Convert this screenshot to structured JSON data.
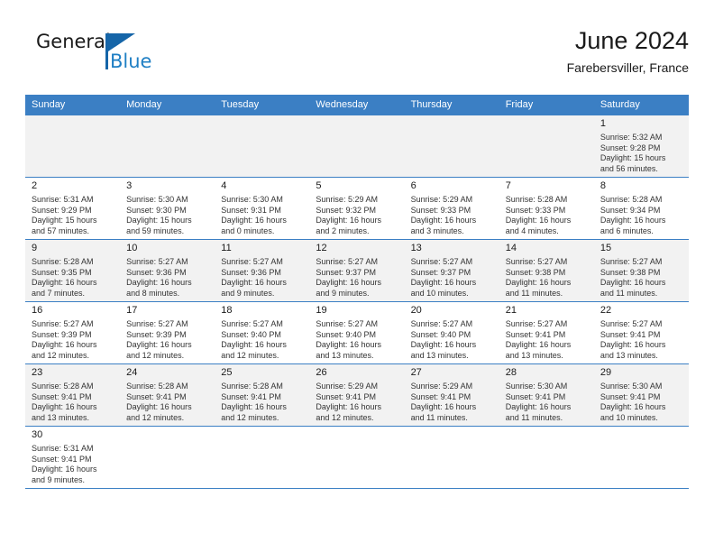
{
  "brand": {
    "name_part1": "General",
    "name_part2": "Blue",
    "logo_icon": "blue-flag-triangle",
    "accent_color": "#1f7fc4"
  },
  "header": {
    "title": "June 2024",
    "subtitle": "Farebersviller, France"
  },
  "theme": {
    "header_row_bg": "#3b7fc4",
    "cell_shade_bg": "#f2f2f2",
    "cell_plain_bg": "#ffffff",
    "border_color": "#3b7fc4"
  },
  "weekdays": [
    "Sunday",
    "Monday",
    "Tuesday",
    "Wednesday",
    "Thursday",
    "Friday",
    "Saturday"
  ],
  "labels": {
    "sunrise": "Sunrise:",
    "sunset": "Sunset:",
    "daylight": "Daylight:"
  },
  "weeks": [
    [
      {
        "day": "",
        "empty": true
      },
      {
        "day": "",
        "empty": true
      },
      {
        "day": "",
        "empty": true
      },
      {
        "day": "",
        "empty": true
      },
      {
        "day": "",
        "empty": true
      },
      {
        "day": "",
        "empty": true
      },
      {
        "day": "1",
        "sunrise": "Sunrise: 5:32 AM",
        "sunset": "Sunset: 9:28 PM",
        "daylight_line1": "Daylight: 15 hours",
        "daylight_line2": "and 56 minutes."
      }
    ],
    [
      {
        "day": "2",
        "sunrise": "Sunrise: 5:31 AM",
        "sunset": "Sunset: 9:29 PM",
        "daylight_line1": "Daylight: 15 hours",
        "daylight_line2": "and 57 minutes."
      },
      {
        "day": "3",
        "sunrise": "Sunrise: 5:30 AM",
        "sunset": "Sunset: 9:30 PM",
        "daylight_line1": "Daylight: 15 hours",
        "daylight_line2": "and 59 minutes."
      },
      {
        "day": "4",
        "sunrise": "Sunrise: 5:30 AM",
        "sunset": "Sunset: 9:31 PM",
        "daylight_line1": "Daylight: 16 hours",
        "daylight_line2": "and 0 minutes."
      },
      {
        "day": "5",
        "sunrise": "Sunrise: 5:29 AM",
        "sunset": "Sunset: 9:32 PM",
        "daylight_line1": "Daylight: 16 hours",
        "daylight_line2": "and 2 minutes."
      },
      {
        "day": "6",
        "sunrise": "Sunrise: 5:29 AM",
        "sunset": "Sunset: 9:33 PM",
        "daylight_line1": "Daylight: 16 hours",
        "daylight_line2": "and 3 minutes."
      },
      {
        "day": "7",
        "sunrise": "Sunrise: 5:28 AM",
        "sunset": "Sunset: 9:33 PM",
        "daylight_line1": "Daylight: 16 hours",
        "daylight_line2": "and 4 minutes."
      },
      {
        "day": "8",
        "sunrise": "Sunrise: 5:28 AM",
        "sunset": "Sunset: 9:34 PM",
        "daylight_line1": "Daylight: 16 hours",
        "daylight_line2": "and 6 minutes."
      }
    ],
    [
      {
        "day": "9",
        "sunrise": "Sunrise: 5:28 AM",
        "sunset": "Sunset: 9:35 PM",
        "daylight_line1": "Daylight: 16 hours",
        "daylight_line2": "and 7 minutes."
      },
      {
        "day": "10",
        "sunrise": "Sunrise: 5:27 AM",
        "sunset": "Sunset: 9:36 PM",
        "daylight_line1": "Daylight: 16 hours",
        "daylight_line2": "and 8 minutes."
      },
      {
        "day": "11",
        "sunrise": "Sunrise: 5:27 AM",
        "sunset": "Sunset: 9:36 PM",
        "daylight_line1": "Daylight: 16 hours",
        "daylight_line2": "and 9 minutes."
      },
      {
        "day": "12",
        "sunrise": "Sunrise: 5:27 AM",
        "sunset": "Sunset: 9:37 PM",
        "daylight_line1": "Daylight: 16 hours",
        "daylight_line2": "and 9 minutes."
      },
      {
        "day": "13",
        "sunrise": "Sunrise: 5:27 AM",
        "sunset": "Sunset: 9:37 PM",
        "daylight_line1": "Daylight: 16 hours",
        "daylight_line2": "and 10 minutes."
      },
      {
        "day": "14",
        "sunrise": "Sunrise: 5:27 AM",
        "sunset": "Sunset: 9:38 PM",
        "daylight_line1": "Daylight: 16 hours",
        "daylight_line2": "and 11 minutes."
      },
      {
        "day": "15",
        "sunrise": "Sunrise: 5:27 AM",
        "sunset": "Sunset: 9:38 PM",
        "daylight_line1": "Daylight: 16 hours",
        "daylight_line2": "and 11 minutes."
      }
    ],
    [
      {
        "day": "16",
        "sunrise": "Sunrise: 5:27 AM",
        "sunset": "Sunset: 9:39 PM",
        "daylight_line1": "Daylight: 16 hours",
        "daylight_line2": "and 12 minutes."
      },
      {
        "day": "17",
        "sunrise": "Sunrise: 5:27 AM",
        "sunset": "Sunset: 9:39 PM",
        "daylight_line1": "Daylight: 16 hours",
        "daylight_line2": "and 12 minutes."
      },
      {
        "day": "18",
        "sunrise": "Sunrise: 5:27 AM",
        "sunset": "Sunset: 9:40 PM",
        "daylight_line1": "Daylight: 16 hours",
        "daylight_line2": "and 12 minutes."
      },
      {
        "day": "19",
        "sunrise": "Sunrise: 5:27 AM",
        "sunset": "Sunset: 9:40 PM",
        "daylight_line1": "Daylight: 16 hours",
        "daylight_line2": "and 13 minutes."
      },
      {
        "day": "20",
        "sunrise": "Sunrise: 5:27 AM",
        "sunset": "Sunset: 9:40 PM",
        "daylight_line1": "Daylight: 16 hours",
        "daylight_line2": "and 13 minutes."
      },
      {
        "day": "21",
        "sunrise": "Sunrise: 5:27 AM",
        "sunset": "Sunset: 9:41 PM",
        "daylight_line1": "Daylight: 16 hours",
        "daylight_line2": "and 13 minutes."
      },
      {
        "day": "22",
        "sunrise": "Sunrise: 5:27 AM",
        "sunset": "Sunset: 9:41 PM",
        "daylight_line1": "Daylight: 16 hours",
        "daylight_line2": "and 13 minutes."
      }
    ],
    [
      {
        "day": "23",
        "sunrise": "Sunrise: 5:28 AM",
        "sunset": "Sunset: 9:41 PM",
        "daylight_line1": "Daylight: 16 hours",
        "daylight_line2": "and 13 minutes."
      },
      {
        "day": "24",
        "sunrise": "Sunrise: 5:28 AM",
        "sunset": "Sunset: 9:41 PM",
        "daylight_line1": "Daylight: 16 hours",
        "daylight_line2": "and 12 minutes."
      },
      {
        "day": "25",
        "sunrise": "Sunrise: 5:28 AM",
        "sunset": "Sunset: 9:41 PM",
        "daylight_line1": "Daylight: 16 hours",
        "daylight_line2": "and 12 minutes."
      },
      {
        "day": "26",
        "sunrise": "Sunrise: 5:29 AM",
        "sunset": "Sunset: 9:41 PM",
        "daylight_line1": "Daylight: 16 hours",
        "daylight_line2": "and 12 minutes."
      },
      {
        "day": "27",
        "sunrise": "Sunrise: 5:29 AM",
        "sunset": "Sunset: 9:41 PM",
        "daylight_line1": "Daylight: 16 hours",
        "daylight_line2": "and 11 minutes."
      },
      {
        "day": "28",
        "sunrise": "Sunrise: 5:30 AM",
        "sunset": "Sunset: 9:41 PM",
        "daylight_line1": "Daylight: 16 hours",
        "daylight_line2": "and 11 minutes."
      },
      {
        "day": "29",
        "sunrise": "Sunrise: 5:30 AM",
        "sunset": "Sunset: 9:41 PM",
        "daylight_line1": "Daylight: 16 hours",
        "daylight_line2": "and 10 minutes."
      }
    ],
    [
      {
        "day": "30",
        "sunrise": "Sunrise: 5:31 AM",
        "sunset": "Sunset: 9:41 PM",
        "daylight_line1": "Daylight: 16 hours",
        "daylight_line2": "and 9 minutes."
      },
      {
        "day": "",
        "blank": true
      },
      {
        "day": "",
        "blank": true
      },
      {
        "day": "",
        "blank": true
      },
      {
        "day": "",
        "blank": true
      },
      {
        "day": "",
        "blank": true
      },
      {
        "day": "",
        "blank": true
      }
    ]
  ]
}
